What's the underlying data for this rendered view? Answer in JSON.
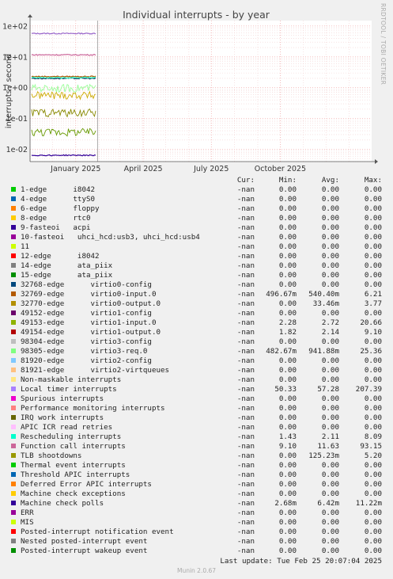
{
  "chart_data": {
    "type": "line",
    "title": "Individual interrupts - by year",
    "ylabel": "interrupts / second",
    "xlabel": "",
    "yscale": "log",
    "ylim": [
      0.004,
      150
    ],
    "yticks": [
      "1e+02",
      "1e+01",
      "1e+00",
      "1e-01",
      "1e-02"
    ],
    "ytick_values": [
      100,
      10,
      1,
      0.1,
      0.01
    ],
    "xticks": [
      "January 2025",
      "April 2025",
      "July 2025",
      "October 2025"
    ],
    "xrange": [
      "2024-11-01",
      "2026-01-31"
    ],
    "xtick_dates": [
      "2025-01-01",
      "2025-04-01",
      "2025-07-01",
      "2025-10-01"
    ],
    "data_end": "2025-01-29",
    "grid": true,
    "series": [
      {
        "name": "Local timer interrupts",
        "color": "#9966cc",
        "level": 57.28
      },
      {
        "name": "Function call interrupts",
        "color": "#cc6699",
        "level": 11.63
      },
      {
        "name": "32769-edge virtio0-input.0",
        "color": "#aa5500",
        "level": 2.3
      },
      {
        "name": "49152-edge virtio1-config",
        "color": "#002a55",
        "level": 2.0
      },
      {
        "name": "98305-edge virtio3-req.0",
        "color": "#99ff99",
        "level": 0.94
      },
      {
        "name": "Rescheduling interrupts",
        "color": "#33ffcc",
        "level": 2.11
      },
      {
        "name": "49153-edge virtio1-input.0",
        "color": "#888800",
        "level": 0.15
      },
      {
        "name": "TLB shootdowns",
        "color": "#669900",
        "level": 0.035
      },
      {
        "name": "32770-edge virtio0-output.0",
        "color": "#ccaa00",
        "level": 0.55
      },
      {
        "name": "Machine check polls",
        "color": "#330099",
        "level": 0.0064
      }
    ]
  },
  "legend": {
    "headers": {
      "cur": "Cur:",
      "min": "Min:",
      "avg": "Avg:",
      "max": "Max:"
    },
    "rows": [
      {
        "label": "1-edge      i8042",
        "color": "#00cc00",
        "cur": "-nan",
        "min": "0.00",
        "avg": "0.00",
        "max": "0.00"
      },
      {
        "label": "4-edge      ttyS0",
        "color": "#0066b3",
        "cur": "-nan",
        "min": "0.00",
        "avg": "0.00",
        "max": "0.00"
      },
      {
        "label": "6-edge      floppy",
        "color": "#ff8000",
        "cur": "-nan",
        "min": "0.00",
        "avg": "0.00",
        "max": "0.00"
      },
      {
        "label": "8-edge      rtc0",
        "color": "#ffcc00",
        "cur": "-nan",
        "min": "0.00",
        "avg": "0.00",
        "max": "0.00"
      },
      {
        "label": "9-fasteoi   acpi",
        "color": "#330099",
        "cur": "-nan",
        "min": "0.00",
        "avg": "0.00",
        "max": "0.00"
      },
      {
        "label": "10-fasteoi   uhci_hcd:usb3, uhci_hcd:usb4",
        "color": "#990099",
        "cur": "-nan",
        "min": "0.00",
        "avg": "0.00",
        "max": "0.00"
      },
      {
        "label": "11",
        "color": "#ccff00",
        "cur": "-nan",
        "min": "0.00",
        "avg": "0.00",
        "max": "0.00"
      },
      {
        "label": "12-edge      i8042",
        "color": "#ff0000",
        "cur": "-nan",
        "min": "0.00",
        "avg": "0.00",
        "max": "0.00"
      },
      {
        "label": "14-edge      ata_piix",
        "color": "#808080",
        "cur": "-nan",
        "min": "0.00",
        "avg": "0.00",
        "max": "0.00"
      },
      {
        "label": "15-edge      ata_piix",
        "color": "#008f00",
        "cur": "-nan",
        "min": "0.00",
        "avg": "0.00",
        "max": "0.00"
      },
      {
        "label": "32768-edge      virtio0-config",
        "color": "#00487d",
        "cur": "-nan",
        "min": "0.00",
        "avg": "0.00",
        "max": "0.00"
      },
      {
        "label": "32769-edge      virtio0-input.0",
        "color": "#b35a00",
        "cur": "-nan",
        "min": "496.67m",
        "avg": "540.40m",
        "max": "6.21"
      },
      {
        "label": "32770-edge      virtio0-output.0",
        "color": "#b38f00",
        "cur": "-nan",
        "min": "0.00",
        "avg": "33.46m",
        "max": "3.77"
      },
      {
        "label": "49152-edge      virtio1-config",
        "color": "#6b006b",
        "cur": "-nan",
        "min": "0.00",
        "avg": "0.00",
        "max": "0.00"
      },
      {
        "label": "49153-edge      virtio1-input.0",
        "color": "#8fb300",
        "cur": "-nan",
        "min": "2.28",
        "avg": "2.72",
        "max": "20.66"
      },
      {
        "label": "49154-edge      virtio1-output.0",
        "color": "#b30000",
        "cur": "-nan",
        "min": "1.82",
        "avg": "2.14",
        "max": "9.10"
      },
      {
        "label": "98304-edge      virtio3-config",
        "color": "#bebebe",
        "cur": "-nan",
        "min": "0.00",
        "avg": "0.00",
        "max": "0.00"
      },
      {
        "label": "98305-edge      virtio3-req.0",
        "color": "#80ff80",
        "cur": "-nan",
        "min": "482.67m",
        "avg": "941.88m",
        "max": "25.36"
      },
      {
        "label": "81920-edge      virtio2-config",
        "color": "#80c9ff",
        "cur": "-nan",
        "min": "0.00",
        "avg": "0.00",
        "max": "0.00"
      },
      {
        "label": "81921-edge      virtio2-virtqueues",
        "color": "#ffc080",
        "cur": "-nan",
        "min": "0.00",
        "avg": "0.00",
        "max": "0.00"
      },
      {
        "label": "Non-maskable interrupts",
        "color": "#ffe680",
        "cur": "-nan",
        "min": "0.00",
        "avg": "0.00",
        "max": "0.00"
      },
      {
        "label": "Local timer interrupts",
        "color": "#aa80ff",
        "cur": "-nan",
        "min": "50.33",
        "avg": "57.28",
        "max": "207.39"
      },
      {
        "label": "Spurious interrupts",
        "color": "#ee00cc",
        "cur": "-nan",
        "min": "0.00",
        "avg": "0.00",
        "max": "0.00"
      },
      {
        "label": "Performance monitoring interrupts",
        "color": "#ff8080",
        "cur": "-nan",
        "min": "0.00",
        "avg": "0.00",
        "max": "0.00"
      },
      {
        "label": "IRQ work interrupts",
        "color": "#666600",
        "cur": "-nan",
        "min": "0.00",
        "avg": "0.00",
        "max": "0.00"
      },
      {
        "label": "APIC ICR read retries",
        "color": "#ffbfff",
        "cur": "-nan",
        "min": "0.00",
        "avg": "0.00",
        "max": "0.00"
      },
      {
        "label": "Rescheduling interrupts",
        "color": "#00ffcc",
        "cur": "-nan",
        "min": "1.43",
        "avg": "2.11",
        "max": "8.09"
      },
      {
        "label": "Function call interrupts",
        "color": "#cc6699",
        "cur": "-nan",
        "min": "9.10",
        "avg": "11.63",
        "max": "93.15"
      },
      {
        "label": "TLB shootdowns",
        "color": "#999900",
        "cur": "-nan",
        "min": "0.00",
        "avg": "125.23m",
        "max": "5.20"
      },
      {
        "label": "Thermal event interrupts",
        "color": "#00cc00",
        "cur": "-nan",
        "min": "0.00",
        "avg": "0.00",
        "max": "0.00"
      },
      {
        "label": "Threshold APIC interrupts",
        "color": "#0066b3",
        "cur": "-nan",
        "min": "0.00",
        "avg": "0.00",
        "max": "0.00"
      },
      {
        "label": "Deferred Error APIC interrupts",
        "color": "#ff8000",
        "cur": "-nan",
        "min": "0.00",
        "avg": "0.00",
        "max": "0.00"
      },
      {
        "label": "Machine check exceptions",
        "color": "#ffcc00",
        "cur": "-nan",
        "min": "0.00",
        "avg": "0.00",
        "max": "0.00"
      },
      {
        "label": "Machine check polls",
        "color": "#330099",
        "cur": "-nan",
        "min": "2.68m",
        "avg": "6.42m",
        "max": "11.22m"
      },
      {
        "label": "ERR",
        "color": "#990099",
        "cur": "-nan",
        "min": "0.00",
        "avg": "0.00",
        "max": "0.00"
      },
      {
        "label": "MIS",
        "color": "#ccff00",
        "cur": "-nan",
        "min": "0.00",
        "avg": "0.00",
        "max": "0.00"
      },
      {
        "label": "Posted-interrupt notification event",
        "color": "#ff0000",
        "cur": "-nan",
        "min": "0.00",
        "avg": "0.00",
        "max": "0.00"
      },
      {
        "label": "Nested posted-interrupt event",
        "color": "#808080",
        "cur": "-nan",
        "min": "0.00",
        "avg": "0.00",
        "max": "0.00"
      },
      {
        "label": "Posted-interrupt wakeup event",
        "color": "#008f00",
        "cur": "-nan",
        "min": "0.00",
        "avg": "0.00",
        "max": "0.00"
      }
    ]
  },
  "footer": {
    "last_update": "Last update: Tue Feb 25 20:07:04 2025",
    "version": "Munin 2.0.67",
    "side_label": "RRDTOOL / TOBI OETIKER"
  }
}
